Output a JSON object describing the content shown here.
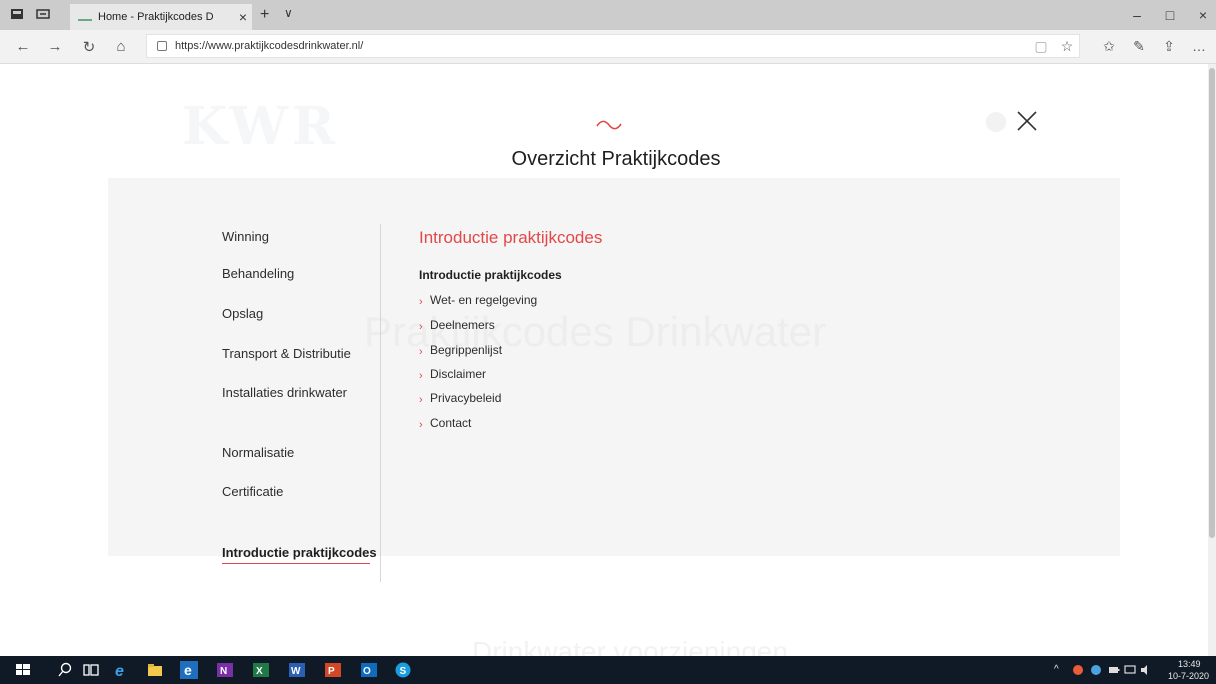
{
  "browser": {
    "tab_title": "Home - Praktijkcodes D",
    "tab_close": "×",
    "new_tab": "+",
    "tab_dropdown": "∨",
    "url": "https://www.praktijkcodesdrinkwater.nl/",
    "window_minimize": "–",
    "window_maximize": "□",
    "window_close": "×"
  },
  "icons": {
    "back": "←",
    "forward": "→",
    "refresh": "↻",
    "home": "⌂",
    "reading_view": "▢",
    "favorite": "☆",
    "favorites_hub": "✩",
    "notes": "✎",
    "share": "⇪",
    "more": "…"
  },
  "background": {
    "logo": "KWR",
    "hero_title": "Praktijkcodes Drinkwater",
    "footer_text": "Drinkwater voorzieningen"
  },
  "menu": {
    "title": "Overzicht Praktijkcodes",
    "left_items": [
      {
        "label": "Winning"
      },
      {
        "label": "Behandeling"
      },
      {
        "label": "Opslag"
      },
      {
        "label": "Transport & Distributie"
      },
      {
        "label": "Installaties drinkwater"
      },
      {
        "label": "Normalisatie"
      },
      {
        "label": "Certificatie"
      },
      {
        "label": "Introductie praktijkcodes"
      }
    ],
    "right_heading": "Introductie praktijkcodes",
    "right_subheading": "Introductie praktijkcodes",
    "right_items": [
      {
        "label": "Wet- en regelgeving"
      },
      {
        "label": "Deelnemers"
      },
      {
        "label": "Begrippenlijst"
      },
      {
        "label": "Disclaimer"
      },
      {
        "label": "Privacybeleid"
      },
      {
        "label": "Contact"
      }
    ],
    "chevron": "›"
  },
  "taskbar": {
    "time": "13:49",
    "date": "10-7-2020"
  },
  "colors": {
    "accent_red": "#e34848",
    "taskbar": "#101a26"
  }
}
